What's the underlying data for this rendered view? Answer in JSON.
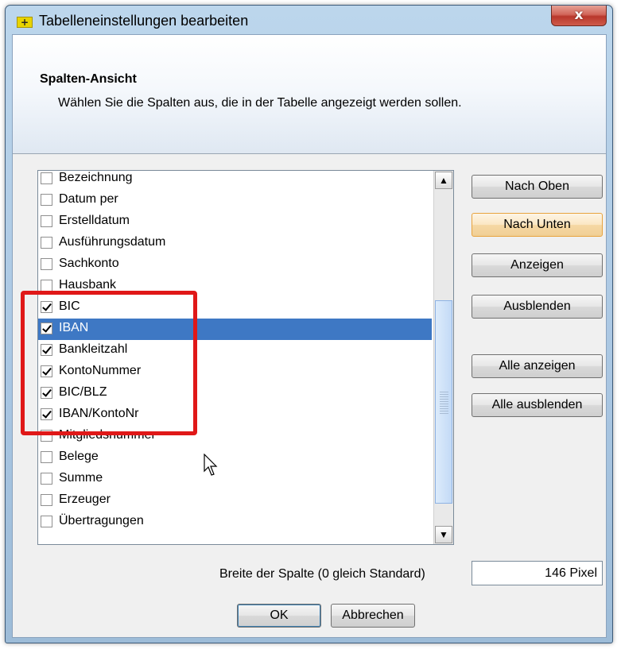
{
  "window": {
    "title": "Tabelleneinstellungen bearbeiten",
    "close_glyph": "x"
  },
  "header": {
    "title": "Spalten-Ansicht",
    "subtitle": "Wählen Sie die Spalten aus, die in der Tabelle angezeigt werden sollen."
  },
  "columns": [
    {
      "label": "Bezeichnung",
      "checked": false
    },
    {
      "label": "Datum per",
      "checked": false
    },
    {
      "label": "Erstelldatum",
      "checked": false
    },
    {
      "label": "Ausführungsdatum",
      "checked": false
    },
    {
      "label": "Sachkonto",
      "checked": false
    },
    {
      "label": "Hausbank",
      "checked": false
    },
    {
      "label": "BIC",
      "checked": true
    },
    {
      "label": "IBAN",
      "checked": true,
      "selected": true
    },
    {
      "label": "Bankleitzahl",
      "checked": true
    },
    {
      "label": "KontoNummer",
      "checked": true
    },
    {
      "label": "BIC/BLZ",
      "checked": true
    },
    {
      "label": "IBAN/KontoNr",
      "checked": true
    },
    {
      "label": "Mitgliedsnummer",
      "checked": false
    },
    {
      "label": "Belege",
      "checked": false
    },
    {
      "label": "Summe",
      "checked": false
    },
    {
      "label": "Erzeuger",
      "checked": false
    },
    {
      "label": "Übertragungen",
      "checked": false
    }
  ],
  "buttons": {
    "up": "Nach Oben",
    "down": "Nach Unten",
    "show": "Anzeigen",
    "hide": "Ausblenden",
    "show_all": "Alle anzeigen",
    "hide_all": "Alle ausblenden",
    "ok": "OK",
    "cancel": "Abbrechen"
  },
  "width": {
    "label": "Breite der Spalte (0 gleich Standard)",
    "value": "146 Pixel"
  },
  "icons": {
    "scroll_up": "▲",
    "scroll_down": "▼"
  },
  "colors": {
    "selection": "#3e78c4",
    "highlight": "#e01818"
  }
}
